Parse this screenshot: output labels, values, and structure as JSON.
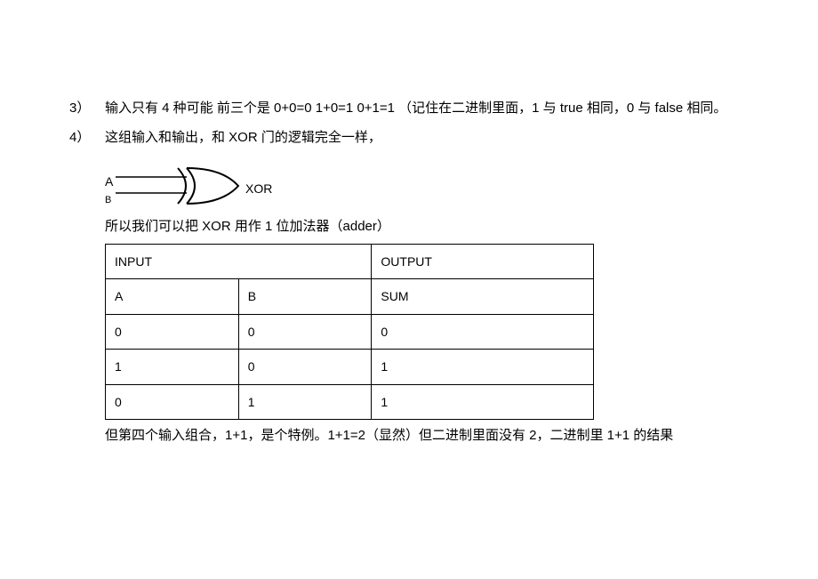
{
  "items": [
    {
      "marker": "3）",
      "text": "输入只有 4 种可能 前三个是 0+0=0 1+0=1 0+1=1   （记住在二进制里面，1 与 true 相同，0 与 false 相同。"
    },
    {
      "marker": "4）",
      "text": "这组输入和输出，和 XOR 门的逻辑完全一样，"
    }
  ],
  "xor": {
    "inputA": "A",
    "inputB": "B",
    "output": "XOR"
  },
  "adder_sentence": "所以我们可以把 XOR 用作 1 位加法器（adder）",
  "table": {
    "header_row": {
      "input": "INPUT",
      "output": "OUTPUT"
    },
    "subheader": {
      "a": "A",
      "b": "B",
      "sum": "SUM"
    },
    "rows": [
      {
        "a": "0",
        "b": "0",
        "sum": "0"
      },
      {
        "a": "1",
        "b": "0",
        "sum": "1"
      },
      {
        "a": "0",
        "b": "1",
        "sum": "1"
      }
    ]
  },
  "after_table": "但第四个输入组合，1+1，是个特例。1+1=2（显然）但二进制里面没有 2，二进制里 1+1 的结果"
}
